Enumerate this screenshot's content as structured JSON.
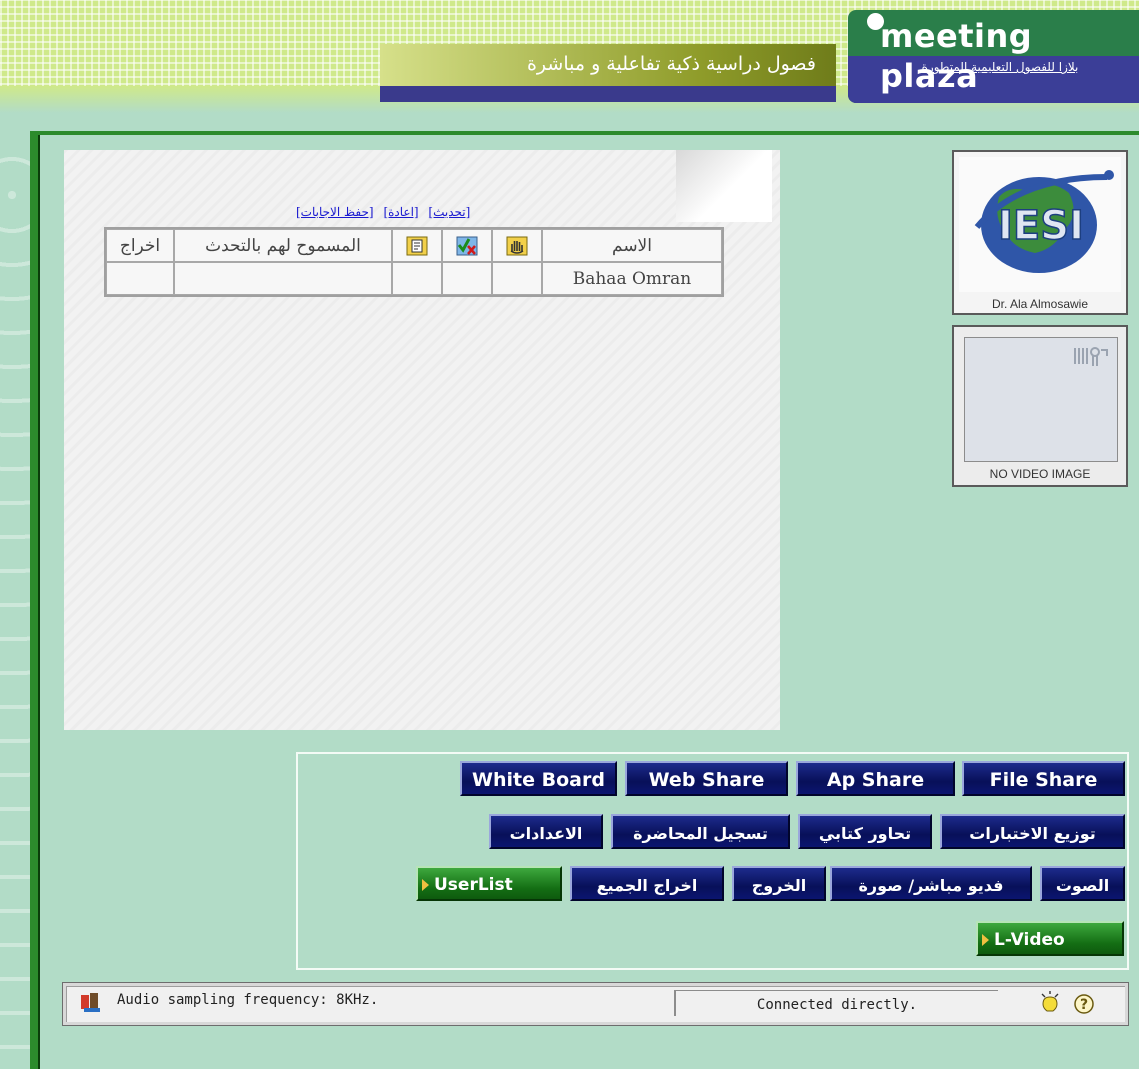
{
  "header": {
    "logo_text": "meeting plaza",
    "logo_subtitle": "بلازا للفصول التعليمية المتطورة",
    "slogan": "فصول دراسية ذكية تفاعلية و مباشرة"
  },
  "userlist": {
    "links": [
      "[تحديث]",
      "[اعادة]",
      "[حفظ الاجابات]"
    ],
    "columns": {
      "name": "الاسم",
      "allowed_to_speak": "المسموح لهم بالتحدث",
      "kick": "اخراج"
    },
    "rows": [
      {
        "name": "Bahaa Omran"
      }
    ]
  },
  "camera": {
    "label": "Dr. Ala Almosawie",
    "logo_text": "IESI"
  },
  "novideo": {
    "label": "NO VIDEO IMAGE"
  },
  "buttons": {
    "white_board": "White Board",
    "web_share": "Web Share",
    "ap_share": "Ap Share",
    "file_share": "File Share",
    "quiz": "توزيع الاختبارات",
    "chat": "تحاور كتابي",
    "record": "تسجيل المحاضرة",
    "settings": "الاعدادات",
    "audio": "الصوت",
    "video": "فديو مباشر/ صورة",
    "exit": "الخروج",
    "kick_all": "اخراج الجميع",
    "userlist": "UserList",
    "lvideo": "L-Video"
  },
  "status": {
    "audio_msg": "Audio sampling frequency: 8KHz.",
    "connection": "Connected directly.",
    "help_glyph": "?"
  },
  "colors": {
    "background": "#b2dcc7",
    "button_blue": "#081059",
    "button_green": "#146f14",
    "frame_green": "#2c8b2c"
  }
}
